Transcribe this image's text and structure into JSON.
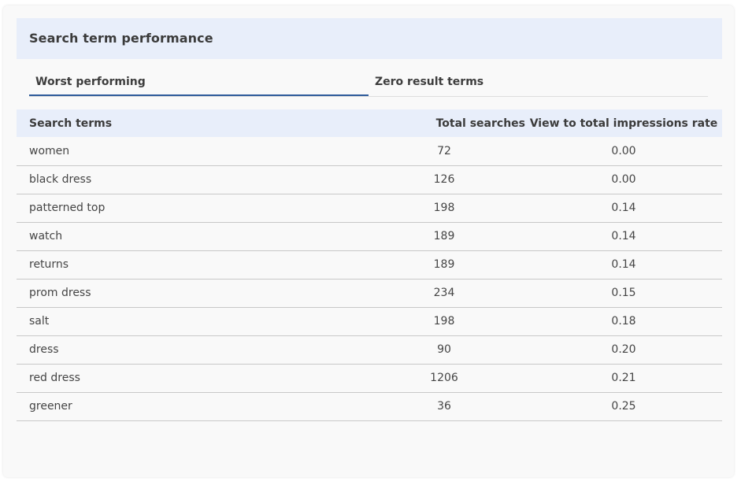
{
  "card": {
    "title": "Search term performance"
  },
  "tabs": [
    {
      "label": "Worst performing",
      "active": true
    },
    {
      "label": "Zero result terms",
      "active": false
    }
  ],
  "table": {
    "headers": {
      "term": "Search terms",
      "searches": "Total searches",
      "rate": "View to total impressions rate"
    },
    "rows": [
      {
        "term": "women",
        "searches": "72",
        "rate": "0.00"
      },
      {
        "term": "black dress",
        "searches": "126",
        "rate": "0.00"
      },
      {
        "term": "patterned top",
        "searches": "198",
        "rate": "0.14"
      },
      {
        "term": "watch",
        "searches": "189",
        "rate": "0.14"
      },
      {
        "term": "returns",
        "searches": "189",
        "rate": "0.14"
      },
      {
        "term": "prom dress",
        "searches": "234",
        "rate": "0.15"
      },
      {
        "term": "salt",
        "searches": "198",
        "rate": "0.18"
      },
      {
        "term": "dress",
        "searches": "90",
        "rate": "0.20"
      },
      {
        "term": "red dress",
        "searches": "1206",
        "rate": "0.21"
      },
      {
        "term": "greener",
        "searches": "36",
        "rate": "0.25"
      }
    ]
  },
  "colors": {
    "header_background": "#e8eefa",
    "active_tab_underline": "#2d5b9a",
    "card_background": "#f9f9f9"
  }
}
